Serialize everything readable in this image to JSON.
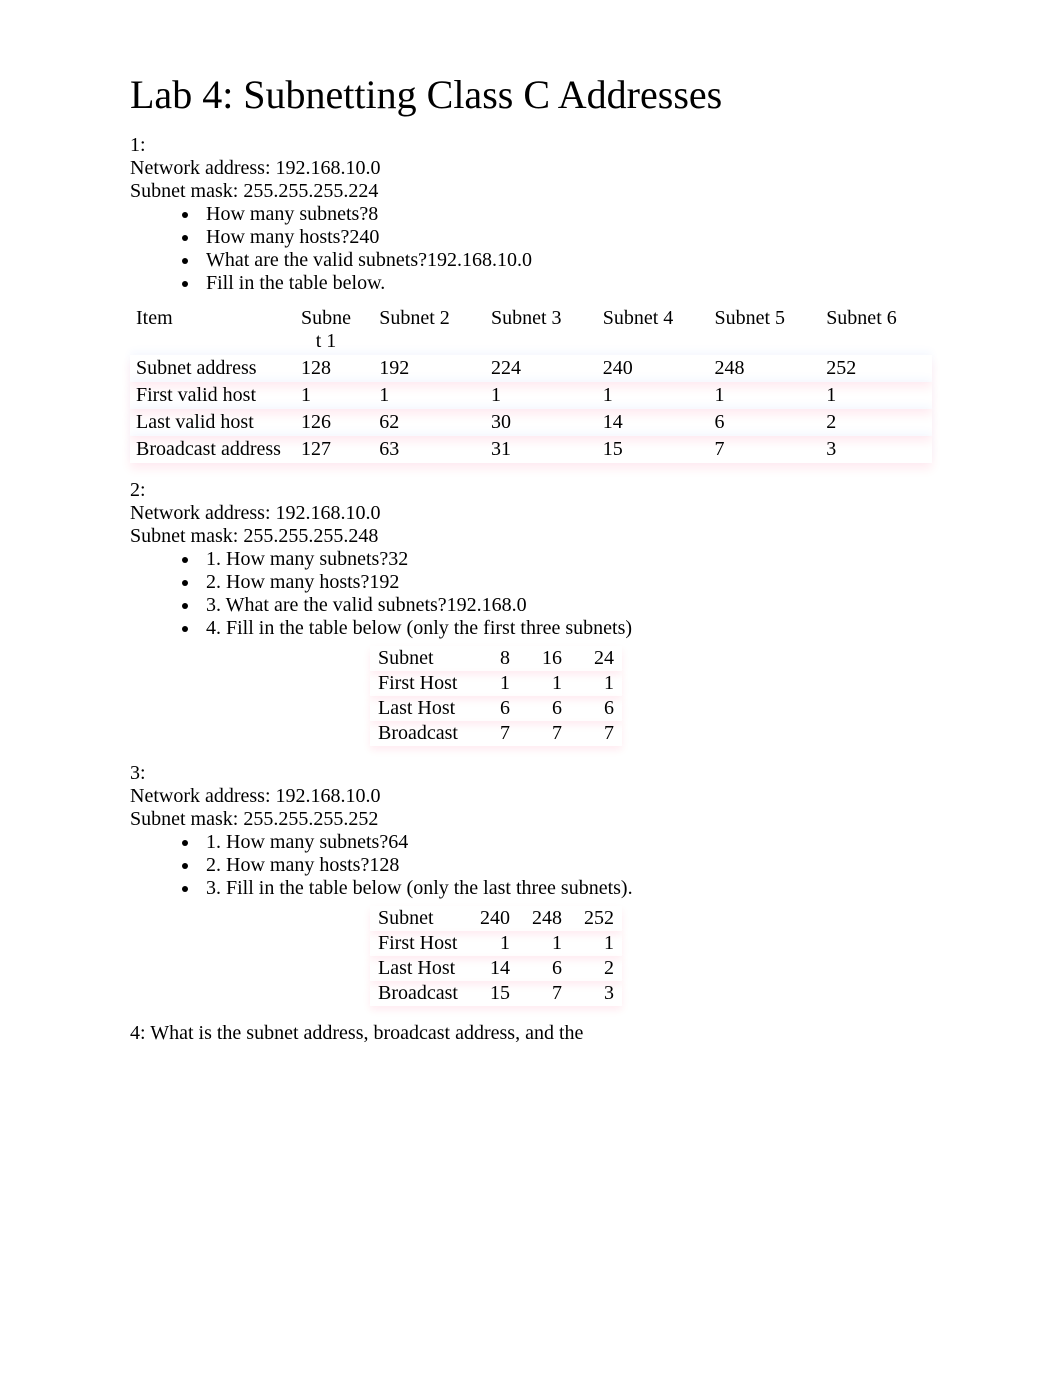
{
  "title": "Lab 4: Subnetting Class C Addresses",
  "q1": {
    "num": "1:",
    "net": "Network address: 192.168.10.0",
    "mask": "Subnet mask: 255.255.255.224",
    "b1": "How many subnets?8",
    "b2": "How many hosts?240",
    "b3": "What are the valid subnets?192.168.10.0",
    "b4": "Fill in the table below.",
    "headers": [
      "Item",
      "Subnet 1",
      "Subnet 2",
      "Subnet 3",
      "Subnet 4",
      "Subnet 5",
      "Subnet 6"
    ],
    "rows": [
      [
        "Subnet address",
        "128",
        "192",
        "224",
        "240",
        "248",
        "252"
      ],
      [
        "First valid host",
        "1",
        "1",
        "1",
        "1",
        "1",
        "1"
      ],
      [
        "Last valid host",
        "126",
        "62",
        "30",
        "14",
        "6",
        "2"
      ],
      [
        "Broadcast address",
        "127",
        "63",
        "31",
        "15",
        "7",
        "3"
      ]
    ]
  },
  "q2": {
    "num": "2:",
    "net": "Network address: 192.168.10.0",
    "mask": "Subnet mask: 255.255.255.248",
    "b1": "1. How many subnets?32",
    "b2": "2. How many hosts?192",
    "b3": "3. What are the valid subnets?192.168.0",
    "b4": "4. Fill in the table below (only the first three subnets)",
    "rows": [
      [
        "Subnet",
        "8",
        "16",
        "24"
      ],
      [
        "First Host",
        "1",
        "1",
        "1"
      ],
      [
        "Last Host",
        "6",
        "6",
        "6"
      ],
      [
        "Broadcast",
        "7",
        "7",
        "7"
      ]
    ]
  },
  "q3": {
    "num": "3:",
    "net": "Network address: 192.168.10.0",
    "mask": "Subnet mask: 255.255.255.252",
    "b1": "1. How many subnets?64",
    "b2": "2. How many hosts?128",
    "b3": "3. Fill in the table below (only the last three subnets).",
    "rows": [
      [
        "Subnet",
        "240",
        "248",
        "252"
      ],
      [
        "First Host",
        "1",
        "1",
        "1"
      ],
      [
        "Last Host",
        "14",
        "6",
        "2"
      ],
      [
        "Broadcast",
        "15",
        "7",
        "3"
      ]
    ]
  },
  "q4": {
    "text": "4: What is the subnet address, broadcast address, and the"
  }
}
